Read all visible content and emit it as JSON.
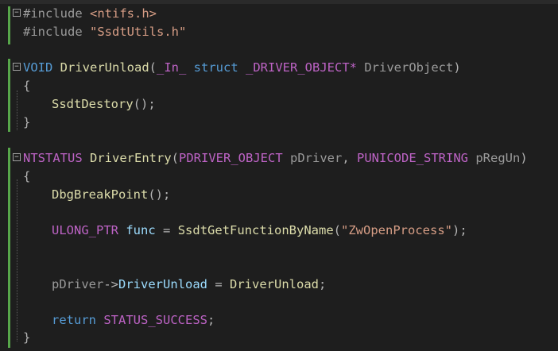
{
  "editor": {
    "lines": {
      "l1": {
        "pp": "#include",
        "header": "<ntifs.h>"
      },
      "l2": {
        "pp": "#include",
        "header": "\"SsdtUtils.h\""
      },
      "l4": {
        "ret": "VOID",
        "name": "DriverUnload",
        "open": "(",
        "ann": "_In_",
        "kw": "struct",
        "type": "_DRIVER_OBJECT*",
        "param": "DriverObject",
        "close": ")"
      },
      "l5": {
        "text": "{"
      },
      "l6": {
        "call": "SsdtDestory",
        "tail": "();"
      },
      "l7": {
        "text": "}"
      },
      "l9": {
        "ret": "NTSTATUS",
        "name": "DriverEntry",
        "open": "(",
        "type1": "PDRIVER_OBJECT",
        "param1": "pDriver",
        "comma": ",",
        "type2": "PUNICODE_STRING",
        "param2": "pRegUn",
        "close": ")"
      },
      "l10": {
        "text": "{"
      },
      "l11": {
        "call": "DbgBreakPoint",
        "tail": "();"
      },
      "l13": {
        "type": "ULONG_PTR",
        "var": "func",
        "eq": "=",
        "call": "SsdtGetFunctionByName",
        "open": "(",
        "str": "\"ZwOpenProcess\"",
        "tail": ");"
      },
      "l16": {
        "obj": "pDriver",
        "arrow": "->",
        "member": "DriverUnload",
        "eq": "=",
        "rhs": "DriverUnload",
        "tail": ";"
      },
      "l18": {
        "kw": "return",
        "value": "STATUS_SUCCESS",
        "tail": ";"
      },
      "l19": {
        "text": "}"
      }
    }
  }
}
